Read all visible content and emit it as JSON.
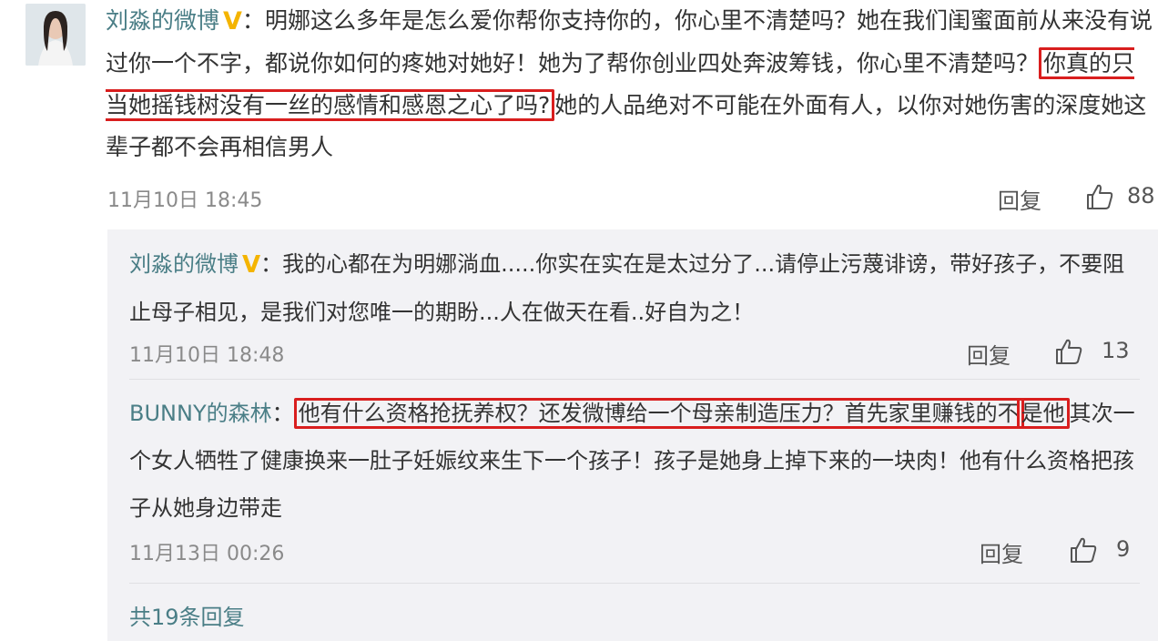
{
  "main_comment": {
    "username": "刘淼的微博",
    "verified_badge": "V",
    "separator": "：",
    "text_before": "明娜这么多年是怎么爱你帮你支持你的，你心里不清楚吗？她在我们闺蜜面前从来没有说过你一个不字，都说你如何的疼她对她好！她为了帮你创业四处奔波筹钱，你心里不清楚吗？",
    "text_highlight": "你真的只当她摇钱树没有一丝的感情和感恩之心了吗?",
    "text_after": "她的人品绝对不可能在外面有人，以你对她伤害的深度她这辈子都不会再相信男人",
    "timestamp": "11月10日 18:45",
    "reply_label": "回复",
    "like_count": "88",
    "avatar_icon": "user-avatar-icon"
  },
  "replies": [
    {
      "username": "刘淼的微博",
      "verified_badge": "V",
      "separator": "：",
      "text": "我的心都在为明娜淌血.....你实在实在是太过分了...请停止污蔑诽谤，带好孩子，不要阻止母子相见，是我们对您唯一的期盼...人在做天在看..好自为之！",
      "timestamp": "11月10日 18:48",
      "reply_label": "回复",
      "like_count": "13"
    },
    {
      "username": "BUNNY的森林",
      "separator": "：",
      "text_highlight_1": "他有什么资格抢抚养权？还发微博给一个母亲制造压力？首先家里赚钱的不",
      "text_highlight_2": "是他",
      "text_after": "其次一个女人牺牲了健康换来一肚子妊娠纹来生下一个孩子！孩子是她身上掉下来的一块肉！他有什么资格把孩子从她身边带走",
      "timestamp": "11月13日 00:26",
      "reply_label": "回复",
      "like_count": "9"
    }
  ],
  "total_replies": "共19条回复",
  "colors": {
    "username": "#4a7e86",
    "highlight_border": "#d91e1e",
    "badge": "#f4b400",
    "panel_bg": "#f2f2f5"
  }
}
